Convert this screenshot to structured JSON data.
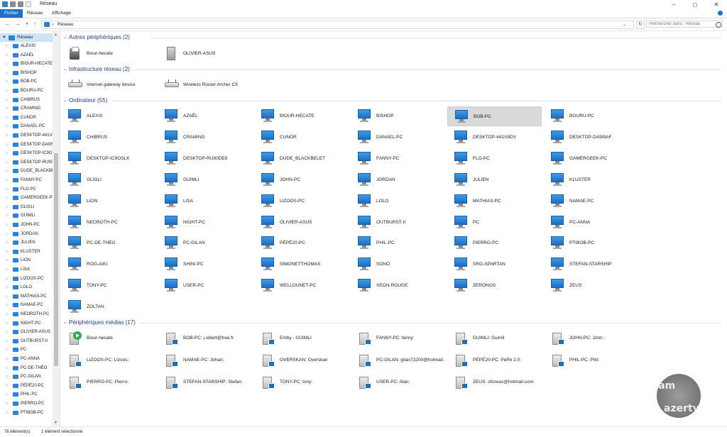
{
  "window": {
    "title": "Réseau"
  },
  "ribbon": {
    "tabs": [
      {
        "label": "Fichier",
        "active": true
      },
      {
        "label": "Réseau"
      },
      {
        "label": "Affichage"
      }
    ]
  },
  "address": {
    "path": "Réseau",
    "separator": "›",
    "search_placeholder": "Rechercher dans : Réseau"
  },
  "colors": {
    "accent": "#1a73c9",
    "group_title": "#1f3f8f",
    "selected": "#d9d9d9",
    "sidebar_selected": "#cce4f7"
  },
  "sidebar": {
    "root": "Réseau",
    "items": [
      "ALEXIS",
      "AZAËL",
      "BIOUR-HECATE",
      "BISHOP",
      "BOB-PC",
      "BOURU-PC",
      "CHIBRUS",
      "CRAMING",
      "CUNOR",
      "DANAEL-PC",
      "DESKTOP-441V9",
      "DESKTOP-DA9I9",
      "DESKTOP-IC9OS",
      "DESKTOP-RU90E",
      "DUDE_BLACKBEI",
      "FANNY-PC",
      "FLO-PC",
      "GAMERGEEK-PC",
      "GLIGLI",
      "GUIMLI",
      "JOHN-PC",
      "JORDAN",
      "JULIEN",
      "KLUSTER",
      "LION",
      "LISA",
      "LIZOOS-PC",
      "LOLO",
      "MATHIAS-PC",
      "NAMAE-PC",
      "NEOROTH-PC",
      "NIGHT-PC",
      "OLIVIER-ASUS",
      "OUTBURST-II",
      "PC",
      "PC-ANNA",
      "PC-DE-THÉO",
      "PC-GILAN",
      "PÉPÉ20-PC",
      "PHIL-PC",
      "PIERRO-PC",
      "PTIBOB-PC"
    ]
  },
  "groups": {
    "autres": {
      "title": "Autres périphériques (2)",
      "items": [
        {
          "label": "Biour-hecate",
          "icon": "printer-icon"
        },
        {
          "label": "OLIVIER-ASUS",
          "icon": "tower-icon"
        }
      ]
    },
    "infra": {
      "title": "Infrastructure réseau (2)",
      "items": [
        {
          "label": "Internet gateway device",
          "icon": "router-icon"
        },
        {
          "label": "Wireless Router Archer C5",
          "icon": "router-icon"
        }
      ]
    },
    "ordinateur": {
      "title": "Ordinateur (55)",
      "selected_index": 4,
      "items": [
        "ALEXIS",
        "AZAËL",
        "BIOUR-HECATE",
        "BISHOP",
        "BOB-PC",
        "BOURU-PC",
        "CHIBRUS",
        "CRAMING",
        "CUNOR",
        "DANAEL-PC",
        "DESKTOP-441V9DV",
        "DESKTOP-DA9I9AF",
        "DESKTOP-IC9OSLK",
        "DESKTOP-RU90DE8",
        "DUDE_BLACKBELET",
        "FANNY-PC",
        "FLO-PC",
        "GAMERGEEK-PC",
        "GLIGLI",
        "GUIMLI",
        "JOHN-PC",
        "JORDAN",
        "JULIEN",
        "KLUSTER",
        "LION",
        "LISA",
        "LIZOOS-PC",
        "LOLO",
        "MATHIAS-PC",
        "NAMAE-PC",
        "NEOROTH-PC",
        "NIGHT-PC",
        "OLIVIER-ASUS",
        "OUTBURST-II",
        "PC",
        "PC-ANNA",
        "PC-DE-THÉO",
        "PC-GILAN",
        "PÉPÉ20-PC",
        "PHIL-PC",
        "PIERRO-PC",
        "PTIBOB-PC",
        "ROG-AIKI",
        "SHINI-PC",
        "SIMONETTHOMAS",
        "SONO",
        "SRG-SPARTAN",
        "STEFAN-STARSHIP",
        "TONY-PC",
        "USER-PC",
        "WELLOUNET-PC",
        "XEON-ROUGE",
        "ZERONOS",
        "ZEUS",
        "ZOLTAN"
      ]
    },
    "medias": {
      "title": "Périphériques médias (17)",
      "items": [
        "Biour-hecate",
        "BOB-PC: j.sibert@free.fr",
        "Emby - GUIMLI",
        "FANNY-PC: fanny:",
        "GUIMLI: Guimli",
        "JOHN-PC: John:",
        "LIZOOS-PC: Lizoos:",
        "NAMAE-PC: Johan:",
        "OVERSKAN: Overskan",
        "PC-GILAN: gilan73200@hotmail.fr:",
        "PÉPÉ20-PC: PéPé 2.0:",
        "PHIL-PC: Phil:",
        "PIERRO-PC: Pierro:",
        "STEFAN-STARSHIP: Stefan:",
        "TONY-PC: tony:",
        "USER-PC: Alan:",
        "ZEUS: sfozeus@hotmail.com:"
      ]
    }
  },
  "status": {
    "count": "76 élément(s)",
    "selection": "1 élément sélectionné"
  },
  "watermark": {
    "line1": "team",
    "line2": "azerty"
  }
}
